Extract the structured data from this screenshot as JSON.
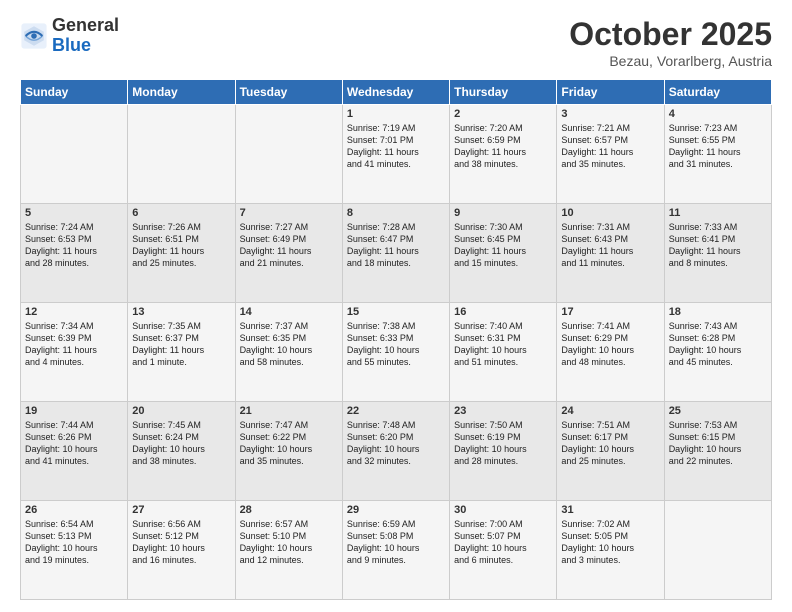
{
  "header": {
    "logo_general": "General",
    "logo_blue": "Blue",
    "month_title": "October 2025",
    "subtitle": "Bezau, Vorarlberg, Austria"
  },
  "days_of_week": [
    "Sunday",
    "Monday",
    "Tuesday",
    "Wednesday",
    "Thursday",
    "Friday",
    "Saturday"
  ],
  "weeks": [
    [
      {
        "day": "",
        "info": ""
      },
      {
        "day": "",
        "info": ""
      },
      {
        "day": "",
        "info": ""
      },
      {
        "day": "1",
        "info": "Sunrise: 7:19 AM\nSunset: 7:01 PM\nDaylight: 11 hours\nand 41 minutes."
      },
      {
        "day": "2",
        "info": "Sunrise: 7:20 AM\nSunset: 6:59 PM\nDaylight: 11 hours\nand 38 minutes."
      },
      {
        "day": "3",
        "info": "Sunrise: 7:21 AM\nSunset: 6:57 PM\nDaylight: 11 hours\nand 35 minutes."
      },
      {
        "day": "4",
        "info": "Sunrise: 7:23 AM\nSunset: 6:55 PM\nDaylight: 11 hours\nand 31 minutes."
      }
    ],
    [
      {
        "day": "5",
        "info": "Sunrise: 7:24 AM\nSunset: 6:53 PM\nDaylight: 11 hours\nand 28 minutes."
      },
      {
        "day": "6",
        "info": "Sunrise: 7:26 AM\nSunset: 6:51 PM\nDaylight: 11 hours\nand 25 minutes."
      },
      {
        "day": "7",
        "info": "Sunrise: 7:27 AM\nSunset: 6:49 PM\nDaylight: 11 hours\nand 21 minutes."
      },
      {
        "day": "8",
        "info": "Sunrise: 7:28 AM\nSunset: 6:47 PM\nDaylight: 11 hours\nand 18 minutes."
      },
      {
        "day": "9",
        "info": "Sunrise: 7:30 AM\nSunset: 6:45 PM\nDaylight: 11 hours\nand 15 minutes."
      },
      {
        "day": "10",
        "info": "Sunrise: 7:31 AM\nSunset: 6:43 PM\nDaylight: 11 hours\nand 11 minutes."
      },
      {
        "day": "11",
        "info": "Sunrise: 7:33 AM\nSunset: 6:41 PM\nDaylight: 11 hours\nand 8 minutes."
      }
    ],
    [
      {
        "day": "12",
        "info": "Sunrise: 7:34 AM\nSunset: 6:39 PM\nDaylight: 11 hours\nand 4 minutes."
      },
      {
        "day": "13",
        "info": "Sunrise: 7:35 AM\nSunset: 6:37 PM\nDaylight: 11 hours\nand 1 minute."
      },
      {
        "day": "14",
        "info": "Sunrise: 7:37 AM\nSunset: 6:35 PM\nDaylight: 10 hours\nand 58 minutes."
      },
      {
        "day": "15",
        "info": "Sunrise: 7:38 AM\nSunset: 6:33 PM\nDaylight: 10 hours\nand 55 minutes."
      },
      {
        "day": "16",
        "info": "Sunrise: 7:40 AM\nSunset: 6:31 PM\nDaylight: 10 hours\nand 51 minutes."
      },
      {
        "day": "17",
        "info": "Sunrise: 7:41 AM\nSunset: 6:29 PM\nDaylight: 10 hours\nand 48 minutes."
      },
      {
        "day": "18",
        "info": "Sunrise: 7:43 AM\nSunset: 6:28 PM\nDaylight: 10 hours\nand 45 minutes."
      }
    ],
    [
      {
        "day": "19",
        "info": "Sunrise: 7:44 AM\nSunset: 6:26 PM\nDaylight: 10 hours\nand 41 minutes."
      },
      {
        "day": "20",
        "info": "Sunrise: 7:45 AM\nSunset: 6:24 PM\nDaylight: 10 hours\nand 38 minutes."
      },
      {
        "day": "21",
        "info": "Sunrise: 7:47 AM\nSunset: 6:22 PM\nDaylight: 10 hours\nand 35 minutes."
      },
      {
        "day": "22",
        "info": "Sunrise: 7:48 AM\nSunset: 6:20 PM\nDaylight: 10 hours\nand 32 minutes."
      },
      {
        "day": "23",
        "info": "Sunrise: 7:50 AM\nSunset: 6:19 PM\nDaylight: 10 hours\nand 28 minutes."
      },
      {
        "day": "24",
        "info": "Sunrise: 7:51 AM\nSunset: 6:17 PM\nDaylight: 10 hours\nand 25 minutes."
      },
      {
        "day": "25",
        "info": "Sunrise: 7:53 AM\nSunset: 6:15 PM\nDaylight: 10 hours\nand 22 minutes."
      }
    ],
    [
      {
        "day": "26",
        "info": "Sunrise: 6:54 AM\nSunset: 5:13 PM\nDaylight: 10 hours\nand 19 minutes."
      },
      {
        "day": "27",
        "info": "Sunrise: 6:56 AM\nSunset: 5:12 PM\nDaylight: 10 hours\nand 16 minutes."
      },
      {
        "day": "28",
        "info": "Sunrise: 6:57 AM\nSunset: 5:10 PM\nDaylight: 10 hours\nand 12 minutes."
      },
      {
        "day": "29",
        "info": "Sunrise: 6:59 AM\nSunset: 5:08 PM\nDaylight: 10 hours\nand 9 minutes."
      },
      {
        "day": "30",
        "info": "Sunrise: 7:00 AM\nSunset: 5:07 PM\nDaylight: 10 hours\nand 6 minutes."
      },
      {
        "day": "31",
        "info": "Sunrise: 7:02 AM\nSunset: 5:05 PM\nDaylight: 10 hours\nand 3 minutes."
      },
      {
        "day": "",
        "info": ""
      }
    ]
  ]
}
